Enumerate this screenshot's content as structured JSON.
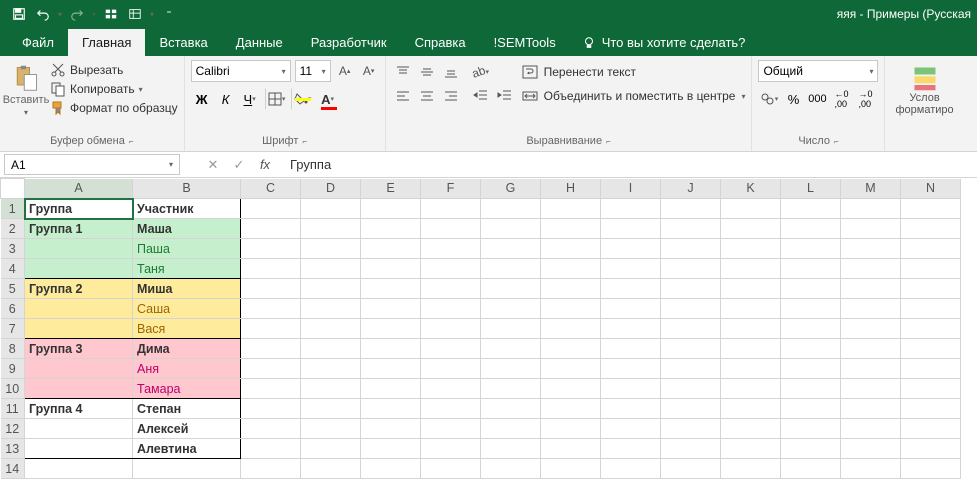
{
  "title": "яяя - Примеры (Русская",
  "tabs": {
    "file": "Файл",
    "home": "Главная",
    "insert": "Вставка",
    "data": "Данные",
    "developer": "Разработчик",
    "help": "Справка",
    "sem": "!SEMTools",
    "tellme": "Что вы хотите сделать?"
  },
  "clipboard": {
    "paste": "Вставить",
    "cut": "Вырезать",
    "copy": "Копировать",
    "format": "Формат по образцу",
    "group": "Буфер обмена"
  },
  "font": {
    "name": "Calibri",
    "size": "11",
    "group": "Шрифт"
  },
  "align": {
    "wrap": "Перенести текст",
    "merge": "Объединить и поместить в центре",
    "group": "Выравнивание"
  },
  "number": {
    "format": "Общий",
    "group": "Число"
  },
  "cond": {
    "l1": "Услов",
    "l2": "форматиро"
  },
  "fx": {
    "cell": "A1",
    "value": "Группа"
  },
  "cols": [
    "A",
    "B",
    "C",
    "D",
    "E",
    "F",
    "G",
    "H",
    "I",
    "J",
    "K",
    "L",
    "M",
    "N"
  ],
  "rows": [
    "1",
    "2",
    "3",
    "4",
    "5",
    "6",
    "7",
    "8",
    "9",
    "10",
    "11",
    "12",
    "13",
    "14"
  ],
  "data": {
    "header": {
      "a": "Группа",
      "b": "Участник"
    },
    "r2": {
      "a": "Группа 1",
      "b": "Маша"
    },
    "r3": {
      "a": "",
      "b": "Паша"
    },
    "r4": {
      "a": "",
      "b": "Таня"
    },
    "r5": {
      "a": "Группа 2",
      "b": "Миша"
    },
    "r6": {
      "a": "",
      "b": "Саша"
    },
    "r7": {
      "a": "",
      "b": "Вася"
    },
    "r8": {
      "a": "Группа 3",
      "b": "Дима"
    },
    "r9": {
      "a": "",
      "b": "Аня"
    },
    "r10": {
      "a": "",
      "b": "Тамара"
    },
    "r11": {
      "a": "Группа 4",
      "b": "Степан"
    },
    "r12": {
      "a": "",
      "b": "Алексей"
    },
    "r13": {
      "a": "",
      "b": "Алевтина"
    }
  }
}
